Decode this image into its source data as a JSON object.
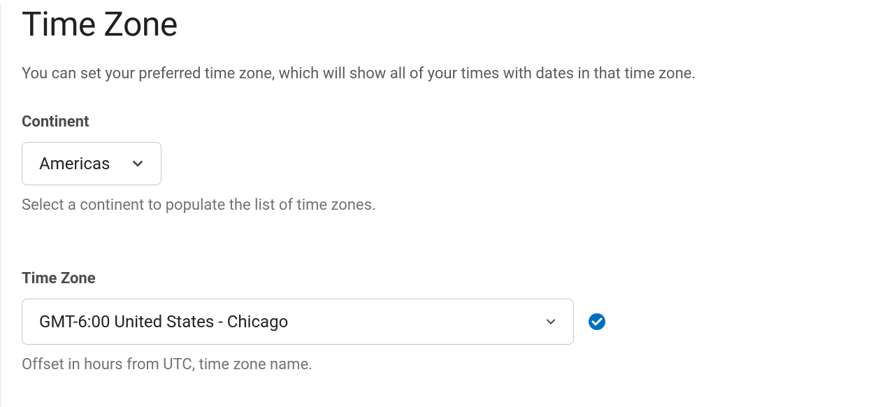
{
  "heading": "Time Zone",
  "description": "You can set your preferred time zone, which will show all of your times with dates in that time zone.",
  "continent": {
    "label": "Continent",
    "selected": "Americas",
    "help": "Select a continent to populate the list of time zones."
  },
  "timezone": {
    "label": "Time Zone",
    "selected": "GMT-6:00 United States - Chicago",
    "help": "Offset in hours from UTC, time zone name."
  },
  "colors": {
    "badge_blue": "#006fbf"
  }
}
